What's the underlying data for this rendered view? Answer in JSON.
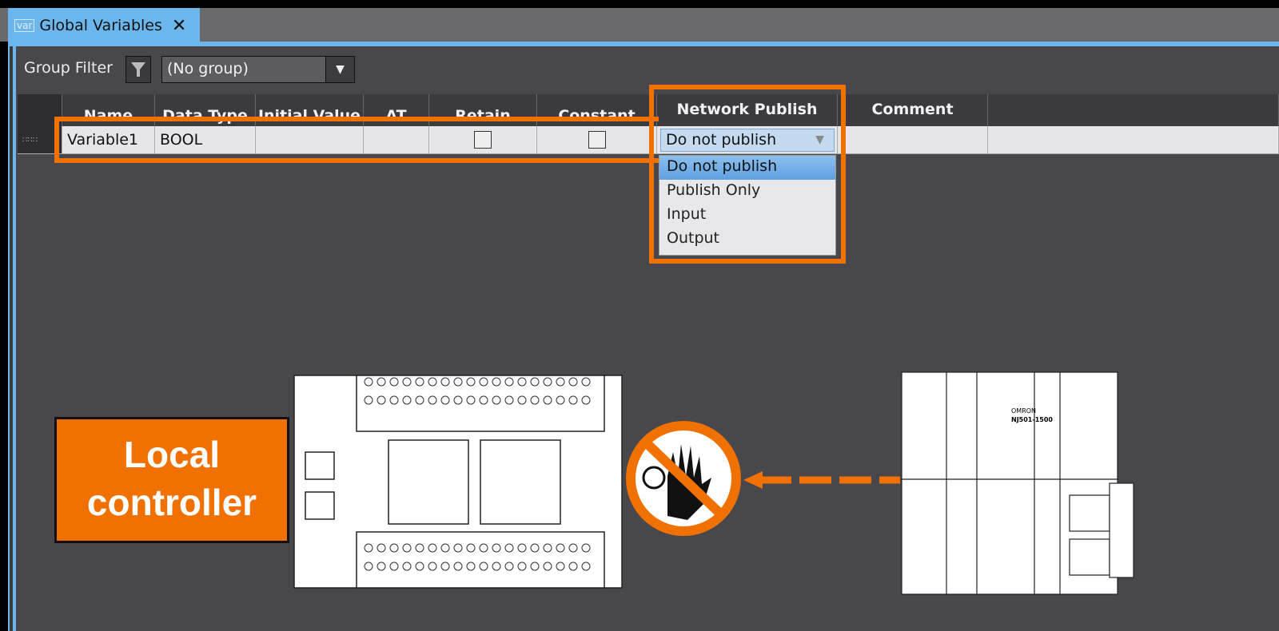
{
  "tab": {
    "icon": "var-icon",
    "icon_text": "var",
    "title": "Global Variables",
    "close": "✕"
  },
  "group_filter": {
    "label": "Group Filter",
    "icon": "filter-icon",
    "value": "(No group)"
  },
  "table": {
    "columns": [
      "Name",
      "Data Type",
      "Initial Value",
      "AT",
      "Retain",
      "Constant",
      "Network Publish",
      "Comment"
    ],
    "rows": [
      {
        "name": "Variable1",
        "data_type": "BOOL",
        "initial_value": "",
        "at": "",
        "retain": false,
        "constant": false,
        "network_publish": "Do not publish",
        "comment": ""
      }
    ]
  },
  "network_publish_options": [
    "Do not publish",
    "Publish Only",
    "Input",
    "Output"
  ],
  "network_publish_selected": "Do not publish",
  "annotation": {
    "label_line1": "Local",
    "label_line2": "controller",
    "highlight_color": "#f07000",
    "prohibited_icon": "no-touch-icon"
  },
  "remote_device": {
    "brand": "OMRON",
    "model": "NJ501-1500"
  }
}
